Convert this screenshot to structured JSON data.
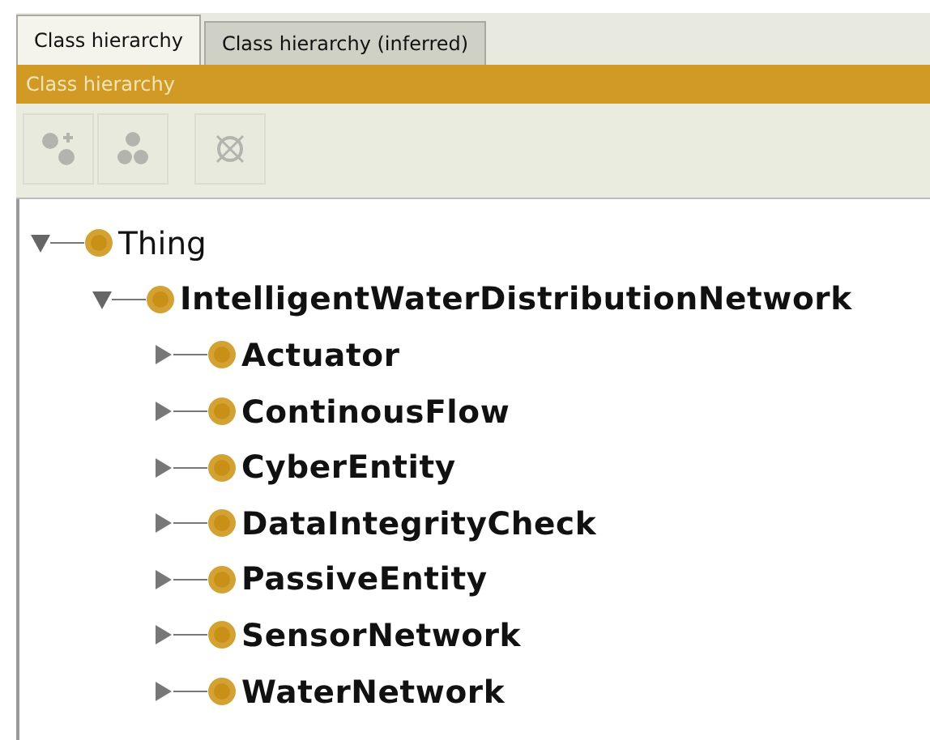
{
  "tabs": [
    {
      "label": "Class hierarchy",
      "selected": true
    },
    {
      "label": "Class hierarchy (inferred)",
      "selected": false
    }
  ],
  "view_title": "Class hierarchy",
  "toolbar": [
    {
      "kind": "add-subclass",
      "disabled": true
    },
    {
      "kind": "add-sibling",
      "disabled": true
    },
    {
      "kind": "delete",
      "disabled": true
    }
  ],
  "tree": [
    {
      "label": "Thing",
      "bold": false,
      "expanded": true,
      "children": [
        {
          "label": "IntelligentWaterDistributionNetwork",
          "bold": true,
          "expanded": true,
          "children": [
            {
              "label": "Actuator",
              "bold": true,
              "expanded": false
            },
            {
              "label": "ContinousFlow",
              "bold": true,
              "expanded": false
            },
            {
              "label": "CyberEntity",
              "bold": true,
              "expanded": false
            },
            {
              "label": "DataIntegrityCheck",
              "bold": true,
              "expanded": false
            },
            {
              "label": "PassiveEntity",
              "bold": true,
              "expanded": false
            },
            {
              "label": "SensorNetwork",
              "bold": true,
              "expanded": false
            },
            {
              "label": "WaterNetwork",
              "bold": true,
              "expanded": false
            }
          ]
        }
      ]
    }
  ]
}
